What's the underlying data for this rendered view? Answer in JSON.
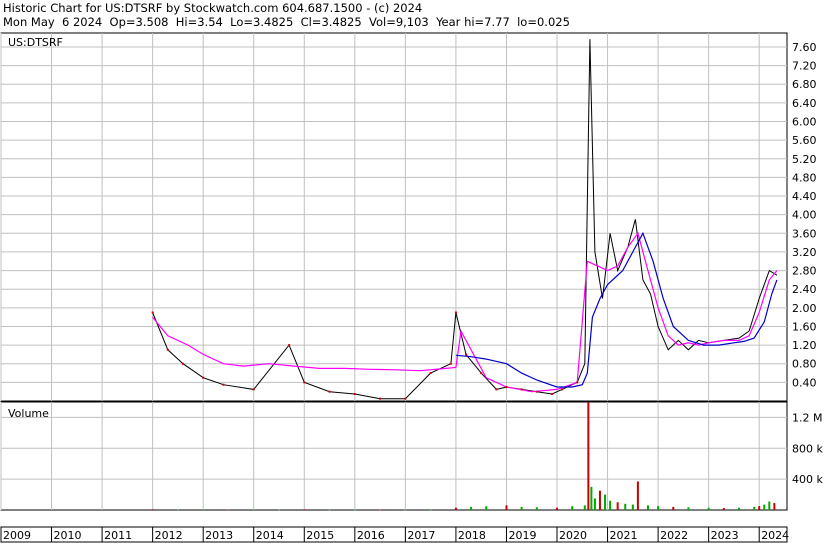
{
  "header": {
    "line1": "Historic Chart for US:DTSRF by Stockwatch.com 604.687.1500 - (c) 2024",
    "line2": "Mon May  6 2024  Op=3.508  Hi=3.54  Lo=3.4825  Cl=3.4825  Vol=9,103  Year hi=7.77  lo=0.025"
  },
  "colors": {
    "price": "#000000",
    "up_day": "#cc0000",
    "ma_short": "#ff00ff",
    "ma_long": "#0000cc",
    "volume_up": "#00aa00",
    "volume_down": "#cc0000",
    "grid": "#c0c0c0"
  },
  "chart_data": [
    {
      "type": "line",
      "title": "US:DTSRF",
      "ylim": [
        0,
        7.9
      ],
      "y_ticks": [
        "0.40",
        "0.80",
        "1.20",
        "1.60",
        "2.00",
        "2.40",
        "2.80",
        "3.20",
        "3.60",
        "4.00",
        "4.40",
        "4.80",
        "5.20",
        "5.60",
        "6.00",
        "6.40",
        "6.80",
        "7.20",
        "7.60"
      ],
      "x_ticks": [
        "2009",
        "2010",
        "2011",
        "2012",
        "2013",
        "2014",
        "2015",
        "2016",
        "2017",
        "2018",
        "2019",
        "2020",
        "2021",
        "2022",
        "2023",
        "2024"
      ],
      "grid": true,
      "series": [
        {
          "color": "#000000",
          "x": [
            2012.0,
            2012.3,
            2012.6,
            2013.0,
            2013.4,
            2014.0,
            2014.7,
            2015.0,
            2015.5,
            2016.0,
            2016.5,
            2017.0,
            2017.5,
            2017.9,
            2018.0,
            2018.2,
            2018.5,
            2018.8,
            2019.0,
            2019.3,
            2019.6,
            2019.9,
            2020.1,
            2020.4,
            2020.55,
            2020.65,
            2020.75,
            2020.9,
            2021.05,
            2021.2,
            2021.4,
            2021.55,
            2021.7,
            2021.85,
            2022.0,
            2022.2,
            2022.4,
            2022.6,
            2022.8,
            2023.0,
            2023.3,
            2023.6,
            2023.8,
            2024.0,
            2024.2,
            2024.35
          ],
          "y": [
            1.9,
            1.1,
            0.8,
            0.5,
            0.35,
            0.25,
            1.2,
            0.4,
            0.2,
            0.15,
            0.05,
            0.05,
            0.6,
            0.8,
            1.9,
            1.0,
            0.6,
            0.25,
            0.3,
            0.25,
            0.2,
            0.15,
            0.25,
            0.4,
            0.8,
            7.77,
            3.2,
            2.2,
            3.6,
            2.8,
            3.3,
            3.9,
            2.6,
            2.3,
            1.6,
            1.1,
            1.3,
            1.1,
            1.3,
            1.25,
            1.3,
            1.35,
            1.5,
            2.2,
            2.8,
            2.7
          ]
        },
        {
          "color": "#ff00ff",
          "x": [
            2012.0,
            2012.3,
            2012.7,
            2013.0,
            2013.4,
            2013.8,
            2014.3,
            2014.8,
            2015.3,
            2015.8,
            2016.3,
            2016.8,
            2017.3,
            2017.8,
            2018.0,
            2018.1,
            2018.3,
            2018.6,
            2019.0,
            2019.5,
            2020.0,
            2020.4,
            2020.6,
            2020.8,
            2021.0,
            2021.2,
            2021.4,
            2021.6,
            2021.8,
            2022.0,
            2022.2,
            2022.4,
            2022.6,
            2022.8,
            2023.0,
            2023.3,
            2023.6,
            2023.8,
            2024.0,
            2024.2,
            2024.35
          ],
          "y": [
            1.8,
            1.4,
            1.2,
            1.0,
            0.8,
            0.75,
            0.8,
            0.75,
            0.7,
            0.7,
            0.68,
            0.67,
            0.65,
            0.7,
            0.72,
            1.5,
            1.1,
            0.5,
            0.3,
            0.2,
            0.25,
            0.4,
            3.0,
            2.9,
            2.8,
            2.9,
            3.3,
            3.6,
            2.8,
            2.0,
            1.4,
            1.2,
            1.25,
            1.2,
            1.25,
            1.3,
            1.3,
            1.4,
            1.9,
            2.6,
            2.8
          ]
        },
        {
          "color": "#0000cc",
          "x": [
            2018.0,
            2018.3,
            2018.6,
            2019.0,
            2019.3,
            2019.6,
            2020.0,
            2020.3,
            2020.5,
            2020.6,
            2020.7,
            2020.85,
            2021.0,
            2021.3,
            2021.5,
            2021.7,
            2021.9,
            2022.1,
            2022.3,
            2022.6,
            2022.9,
            2023.2,
            2023.5,
            2023.7,
            2023.9,
            2024.1,
            2024.25,
            2024.35
          ],
          "y": [
            0.98,
            0.95,
            0.9,
            0.8,
            0.6,
            0.45,
            0.3,
            0.3,
            0.35,
            0.6,
            1.8,
            2.2,
            2.5,
            2.8,
            3.2,
            3.6,
            3.0,
            2.2,
            1.6,
            1.3,
            1.2,
            1.2,
            1.25,
            1.28,
            1.35,
            1.7,
            2.3,
            2.6
          ]
        }
      ]
    },
    {
      "type": "bar",
      "title": "Volume",
      "ylim": [
        0,
        1400000
      ],
      "y_ticks": [
        "400 k",
        "800 k",
        "1.2 M"
      ],
      "x": [
        2012.0,
        2012.5,
        2013.0,
        2013.5,
        2014.0,
        2014.5,
        2015.0,
        2015.5,
        2016.0,
        2016.5,
        2017.0,
        2017.5,
        2018.0,
        2018.3,
        2018.6,
        2019.0,
        2019.3,
        2019.6,
        2020.0,
        2020.3,
        2020.55,
        2020.62,
        2020.68,
        2020.75,
        2020.85,
        2020.95,
        2021.05,
        2021.2,
        2021.35,
        2021.5,
        2021.6,
        2021.8,
        2022.0,
        2022.3,
        2022.6,
        2023.0,
        2023.3,
        2023.6,
        2023.9,
        2024.0,
        2024.1,
        2024.2,
        2024.3
      ],
      "values": [
        10000,
        5000,
        8000,
        5000,
        6000,
        4000,
        9000,
        3000,
        3000,
        2000,
        3000,
        3000,
        30000,
        40000,
        50000,
        60000,
        40000,
        35000,
        30000,
        50000,
        60000,
        1400000,
        300000,
        150000,
        250000,
        200000,
        120000,
        100000,
        80000,
        70000,
        370000,
        60000,
        50000,
        40000,
        35000,
        30000,
        25000,
        30000,
        40000,
        50000,
        70000,
        110000,
        90000
      ]
    }
  ]
}
